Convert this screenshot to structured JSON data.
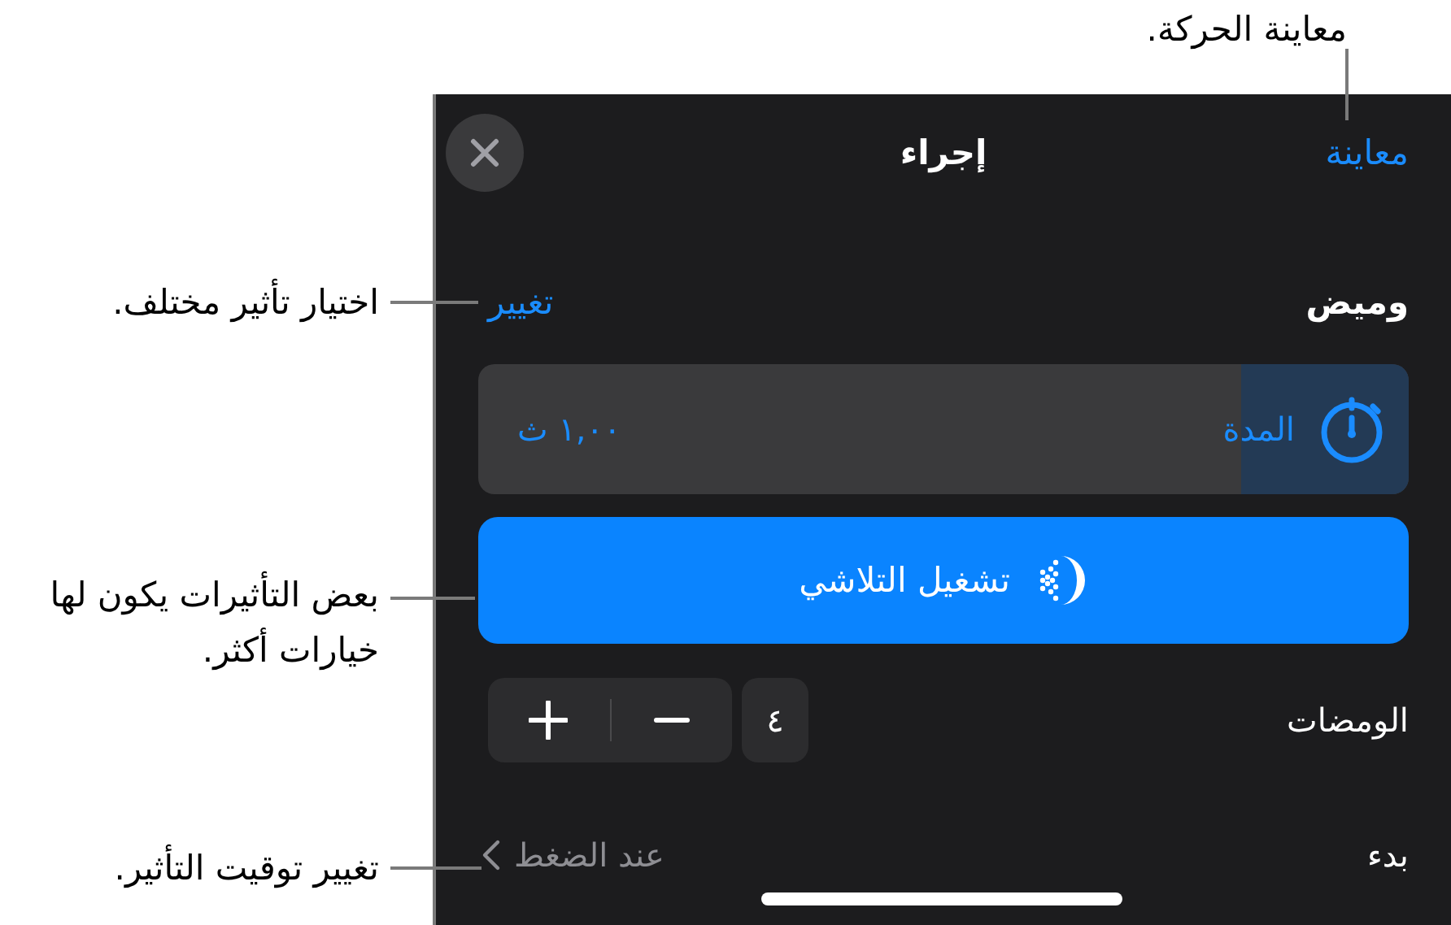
{
  "callouts": [
    {
      "text": "معاينة الحركة."
    },
    {
      "text": "اختيار تأثير مختلف."
    },
    {
      "text": "بعض التأثيرات يكون لها خيارات أكثر."
    },
    {
      "text": "تغيير توقيت التأثير."
    }
  ],
  "header": {
    "title": "إجراء",
    "preview": "معاينة"
  },
  "effect": {
    "name": "وميض",
    "change": "تغيير"
  },
  "duration": {
    "label": "المدة",
    "value": "١,٠٠ ث",
    "level": 0.18
  },
  "play_button": "تشغيل التلاشي",
  "flashes": {
    "label": "الومضات",
    "value": "٤"
  },
  "start": {
    "label": "بدء",
    "value": "عند الضغط"
  }
}
